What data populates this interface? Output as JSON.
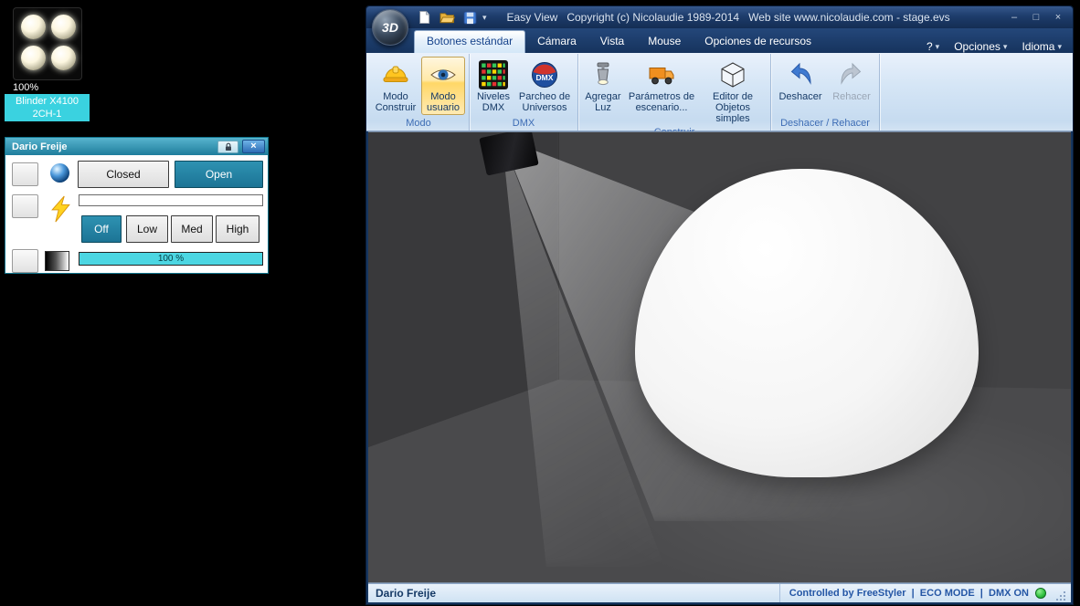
{
  "icons": {
    "minimize": "–",
    "maximize": "□",
    "close": "×",
    "caret": "▾"
  },
  "desktop": {
    "fixture": {
      "intensity": "100%",
      "name": "Blinder X4100",
      "channel": "2CH-1"
    }
  },
  "palette": {
    "title": "Dario Freije",
    "closed": "Closed",
    "open": "Open",
    "off": "Off",
    "low": "Low",
    "med": "Med",
    "high": "High",
    "dimmer_value": "100 %"
  },
  "app": {
    "logo": "3D",
    "title": "Easy View   Copyright (c) Nicolaudie 1989-2014   Web site www.nicolaudie.com - stage.evs",
    "tabs": {
      "standard": "Botones estándar",
      "camera": "Cámara",
      "view": "Vista",
      "mouse": "Mouse",
      "resources": "Opciones de recursos"
    },
    "menus": {
      "help": "?",
      "options": "Opciones",
      "language": "Idioma"
    },
    "ribbon": {
      "modo": {
        "group_label": "Modo",
        "build": "Modo Construir",
        "user": "Modo usuario"
      },
      "dmx": {
        "group_label": "DMX",
        "levels": "Niveles DMX",
        "patch": "Parcheo de Universos",
        "patch_ball_text": "DMX"
      },
      "construir": {
        "group_label": "Construir",
        "add_light": "Agregar Luz",
        "stage_params": "Parámetros de escenario...",
        "object_editor": "Editor de Objetos simples"
      },
      "history": {
        "group_label": "Deshacer / Rehacer",
        "undo": "Deshacer",
        "redo": "Rehacer"
      }
    },
    "statusbar": {
      "left": "Dario Freije",
      "right": "Controlled by FreeStyler  |  ECO MODE  |  DMX ON"
    }
  },
  "colors": {
    "accent_teal": "#1f7f9e",
    "label_cyan": "#3ad2e0",
    "ribbon_highlight": "#ffd767",
    "titlebar_navy": "#1d3c6b",
    "status_green": "#2fbf3f"
  }
}
